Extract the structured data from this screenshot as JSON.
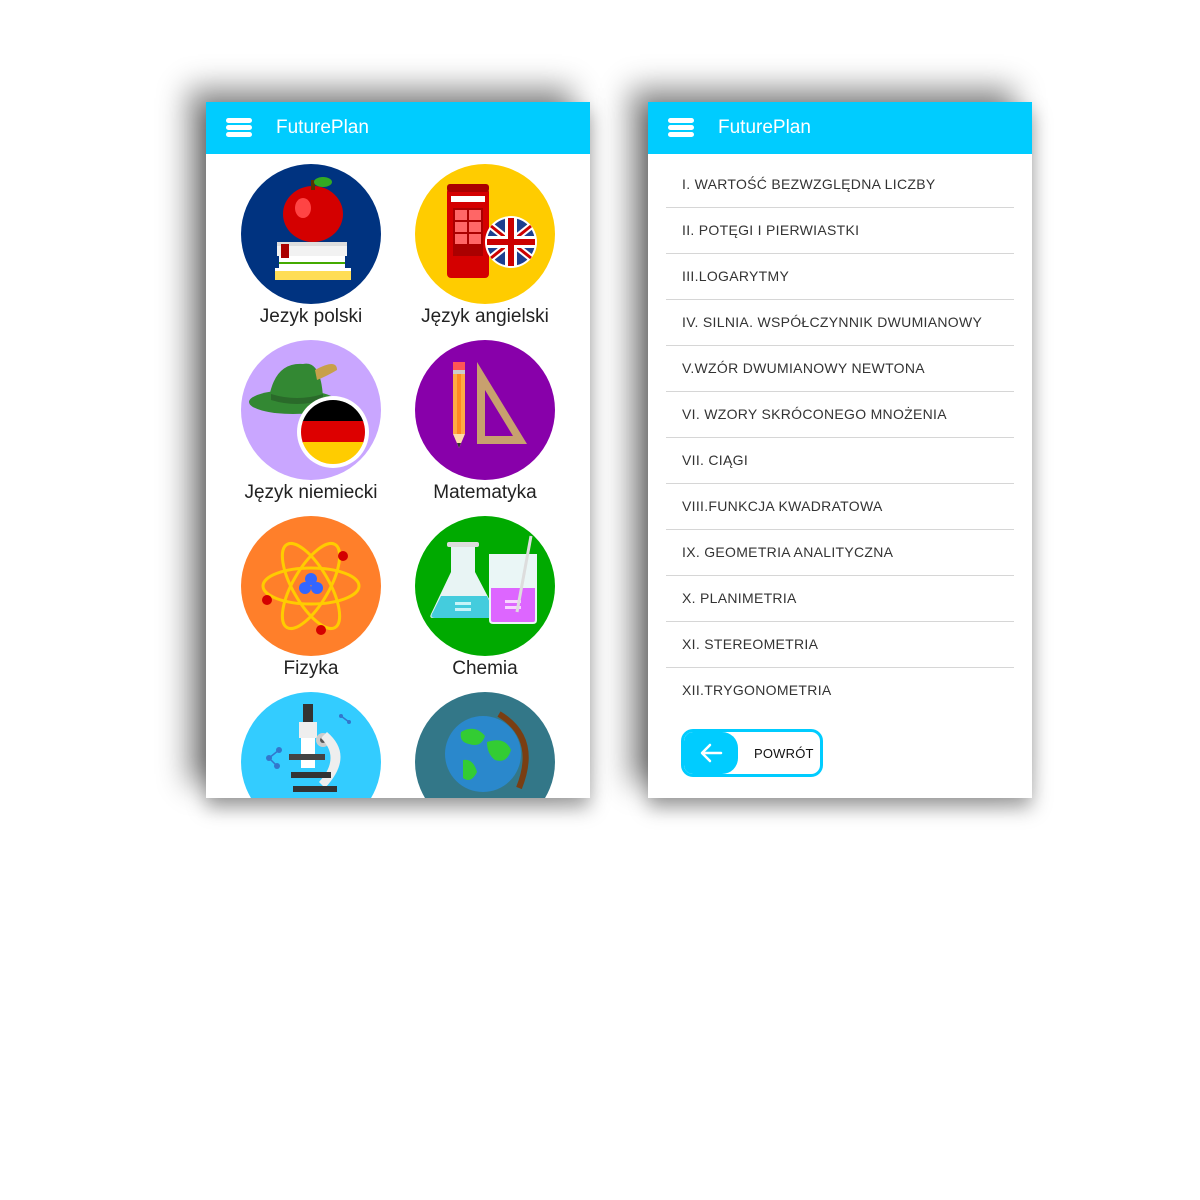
{
  "app": {
    "title": "FuturePlan"
  },
  "subjects": [
    {
      "label": "Jezyk polski"
    },
    {
      "label": "Język angielski"
    },
    {
      "label": "Język niemiecki"
    },
    {
      "label": "Matematyka"
    },
    {
      "label": "Fizyka"
    },
    {
      "label": "Chemia"
    }
  ],
  "topics": [
    "I. WARTOŚĆ BEZWZGLĘDNA LICZBY",
    "II. POTĘGI I PIERWIASTKI",
    "III.LOGARYTMY",
    "IV. SILNIA. WSPÓŁCZYNNIK DWUMIANOWY",
    "V.WZÓR DWUMIANOWY NEWTONA",
    "VI. WZORY SKRÓCONEGO MNOŻENIA",
    "VII. CIĄGI",
    "VIII.FUNKCJA KWADRATOWA",
    "IX. GEOMETRIA ANALITYCZNA",
    "X. PLANIMETRIA",
    "XI. STEREOMETRIA",
    "XII.TRYGONOMETRIA"
  ],
  "back_button": {
    "label": "POWRÓT"
  },
  "colors": {
    "accent": "#00ccff",
    "polski_bg": "#003380",
    "angielski_bg": "#ffcc00",
    "niemiecki_bg": "#c9a6ff",
    "matematyka_bg": "#8800aa",
    "fizyka_bg": "#ff7f2a",
    "chemia_bg": "#00aa00",
    "biologia_bg": "#33ccff",
    "geografia_bg": "#337788"
  },
  "icons": [
    "menu-icon",
    "apple-books-icon",
    "phone-booth-uk-flag-icon",
    "hat-german-flag-icon",
    "pencil-triangle-icon",
    "atom-icon",
    "flask-beaker-icon",
    "microscope-icon",
    "globe-icon",
    "back-arrow-icon"
  ]
}
